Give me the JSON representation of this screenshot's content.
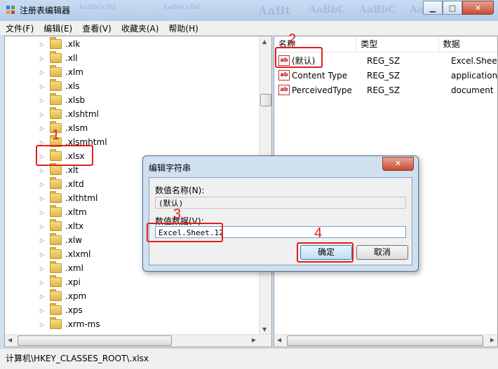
{
  "window": {
    "title": "注册表编辑器",
    "ghost_text": [
      "AaBbCcDd",
      "AaBbCcDd",
      "AaBt",
      "AaBbC",
      "AaBbC",
      "AaBbC"
    ]
  },
  "menu": [
    "文件(F)",
    "编辑(E)",
    "查看(V)",
    "收藏夹(A)",
    "帮助(H)"
  ],
  "tree": {
    "items": [
      ".xlk",
      ".xll",
      ".xlm",
      ".xls",
      ".xlsb",
      ".xlshtml",
      ".xlsm",
      ".xlsmhtml",
      ".xlsx",
      ".xlt",
      ".xltd",
      ".xlthtml",
      ".xltm",
      ".xltx",
      ".xlw",
      ".xlxml",
      ".xml",
      ".xpi",
      ".xpm",
      ".xps",
      ".xrm-ms"
    ],
    "selected": ".xlsx"
  },
  "list": {
    "columns": [
      "名称",
      "类型",
      "数据"
    ],
    "rows": [
      {
        "name": "(默认)",
        "type": "REG_SZ",
        "data": "Excel.Sheet"
      },
      {
        "name": "Content Type",
        "type": "REG_SZ",
        "data": "application"
      },
      {
        "name": "PerceivedType",
        "type": "REG_SZ",
        "data": "document"
      }
    ]
  },
  "dialog": {
    "title": "编辑字符串",
    "name_label": "数值名称(N):",
    "name_value": "(默认)",
    "data_label": "数值数据(V):",
    "data_value": "Excel.Sheet.12",
    "ok": "确定",
    "cancel": "取消"
  },
  "status": {
    "path": "计算机\\HKEY_CLASSES_ROOT\\.xlsx"
  },
  "annotations": [
    "1",
    "2",
    "3",
    "4"
  ],
  "colors": {
    "annotation": "#e0201b",
    "titlebar": "#c7dcf2"
  }
}
